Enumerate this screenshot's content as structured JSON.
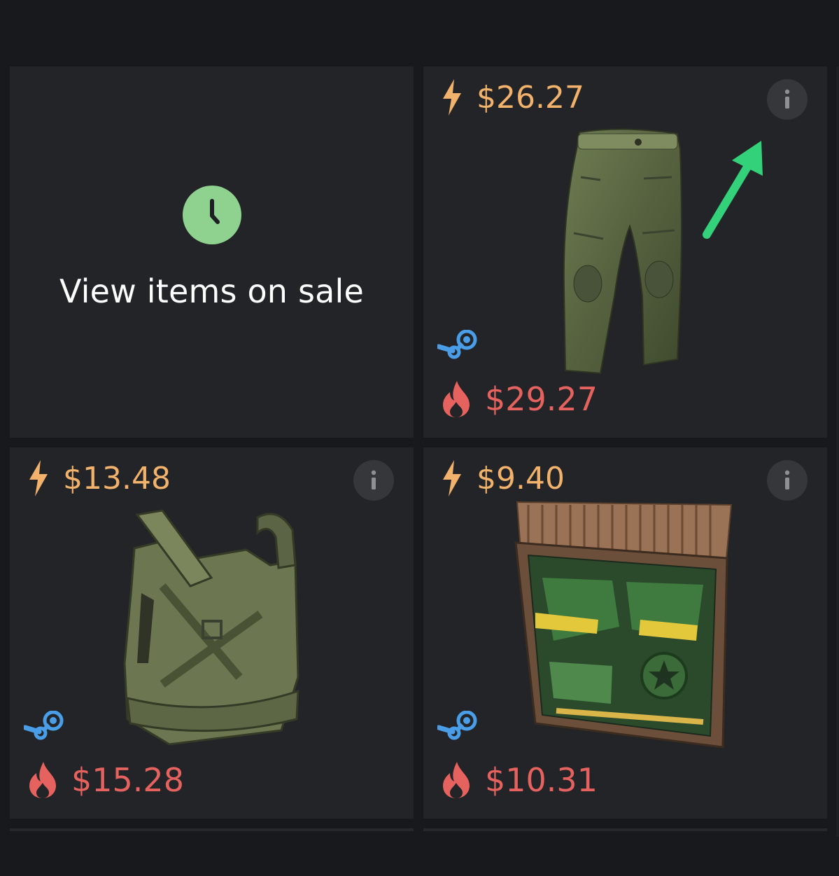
{
  "sale_card": {
    "icon": "clock-icon",
    "label": "View items on sale",
    "accent": "#8fd28f"
  },
  "items": [
    {
      "id": "pants",
      "instant_price": "$26.27",
      "steam_price": "$29.27",
      "image": "green-camo-pants",
      "info_icon": "info-icon"
    },
    {
      "id": "vest",
      "instant_price": "$13.48",
      "steam_price": "$15.28",
      "image": "green-camo-chest-plate",
      "info_icon": "info-icon"
    },
    {
      "id": "door",
      "instant_price": "$9.40",
      "steam_price": "$10.31",
      "image": "military-garage-door",
      "info_icon": "info-icon"
    }
  ],
  "colors": {
    "instant_price": "#f2b26b",
    "steam_price": "#e6625f",
    "steam_logo": "#4a9ee8",
    "card_bg": "#222427",
    "page_bg": "#18191c",
    "annotation_arrow": "#33d17a"
  },
  "annotation": {
    "icon": "arrow-pointer-icon",
    "target": "info-icon"
  }
}
